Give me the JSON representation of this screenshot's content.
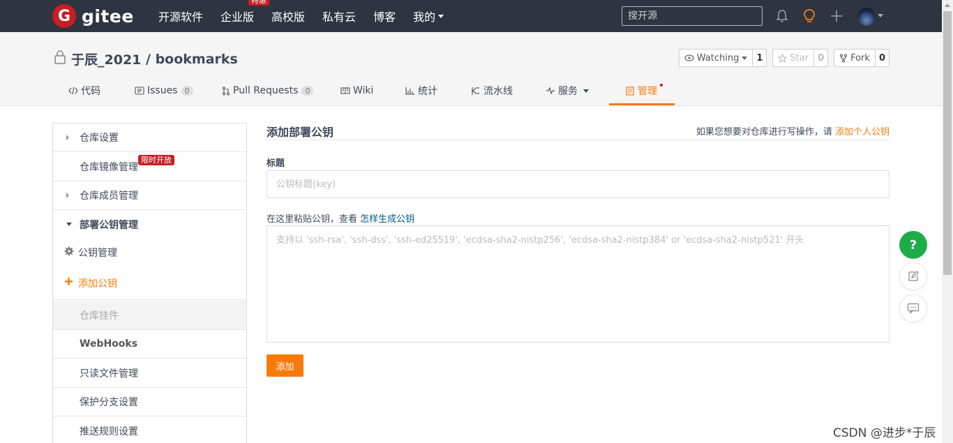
{
  "topnav": {
    "logo_text": "gitee",
    "logo_mark": "G",
    "items": [
      {
        "label": "开源软件"
      },
      {
        "label": "企业版",
        "badge": "特惠"
      },
      {
        "label": "高校版"
      },
      {
        "label": "私有云"
      },
      {
        "label": "博客"
      },
      {
        "label": "我的",
        "dropdown": true
      }
    ],
    "search_placeholder": "搜开源",
    "icons": [
      "bell-icon",
      "lightbulb-icon",
      "plus-icon"
    ],
    "colors": {
      "bg": "#2e3440",
      "brand": "#c71d23",
      "bulb": "#f97a0b"
    }
  },
  "repo": {
    "owner": "于辰_2021",
    "separator": " / ",
    "name": "bookmarks",
    "watching_label": "Watching",
    "watching_count": "1",
    "star_label": "Star",
    "star_count": "0",
    "fork_label": "Fork",
    "fork_count": "0"
  },
  "tabs": [
    {
      "label": "代码",
      "icon": "code-icon"
    },
    {
      "label": "Issues",
      "count": "0",
      "icon": "issues-icon"
    },
    {
      "label": "Pull Requests",
      "count": "0",
      "icon": "pull-request-icon"
    },
    {
      "label": "Wiki",
      "icon": "book-icon"
    },
    {
      "label": "统计",
      "icon": "bar-chart-icon"
    },
    {
      "label": "流水线",
      "icon": "pipeline-icon"
    },
    {
      "label": "服务",
      "icon": "pulse-icon",
      "dropdown": true
    },
    {
      "label": "管理",
      "icon": "manage-icon",
      "active": true
    }
  ],
  "sidebar": {
    "items": [
      {
        "label": "仓库设置",
        "arrow": "right"
      },
      {
        "label": "仓库镜像管理",
        "badge": "限时开放"
      },
      {
        "label": "仓库成员管理",
        "arrow": "right"
      },
      {
        "label": "部署公钥管理",
        "arrow": "down",
        "bold": true
      },
      {
        "label": "公钥管理",
        "icon": "gear-icon"
      },
      {
        "label": "添加公钥",
        "icon": "plus-icon",
        "active": true
      },
      {
        "label": "仓库挂件",
        "disabled": true
      },
      {
        "label": "WebHooks"
      },
      {
        "label": "只读文件管理"
      },
      {
        "label": "保护分支设置"
      },
      {
        "label": "推送规则设置"
      }
    ]
  },
  "form": {
    "title": "添加部署公钥",
    "hint_text": "如果您想要对仓库进行写操作，请 ",
    "hint_link": "添加个人公钥",
    "title_label": "标题",
    "title_placeholder": "公钥标题(key)",
    "key_label": "在这里粘贴公钥，查看 ",
    "key_link": "怎样生成公钥",
    "key_placeholder": "支持以 'ssh-rsa', 'ssh-dss', 'ssh-ed25519', 'ecdsa-sha2-nistp256', 'ecdsa-sha2-nistp384' or 'ecdsa-sha2-nistp521' 开头",
    "submit_label": "添加"
  },
  "floating": {
    "help_label": "?",
    "icons": [
      "edit-icon",
      "chat-icon"
    ]
  },
  "watermark": "CSDN @进步*于辰",
  "colors": {
    "accent": "#f97a0b",
    "help_green": "#1cad48",
    "badge_red": "#c71d23"
  }
}
